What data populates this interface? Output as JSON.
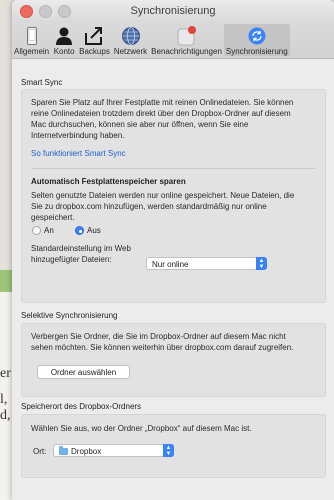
{
  "window": {
    "title": "Synchronisierung"
  },
  "toolbar": [
    {
      "label": "Allgemein",
      "icon": "phone-icon"
    },
    {
      "label": "Konto",
      "icon": "person-icon"
    },
    {
      "label": "Backups",
      "icon": "backup-icon"
    },
    {
      "label": "Netzwerk",
      "icon": "globe-icon"
    },
    {
      "label": "Benachrichtigungen",
      "icon": "notification-icon"
    },
    {
      "label": "Synchronisierung",
      "icon": "sync-icon",
      "active": true
    }
  ],
  "smart_sync": {
    "heading": "Smart Sync",
    "description": [
      "Sparen Sie Platz auf Ihrer Festplatte mit reinen Onlinedateien. Sie können",
      "reine Onlinedateien trotzdem direkt über den Dropbox-Ordner auf diesem",
      "Mac durchsuchen, können sie aber nur öffnen, wenn Sie eine",
      "Internetverbindung haben."
    ],
    "link": "So funktioniert Smart Sync",
    "auto_title": "Automatisch Festplattenspeicher sparen",
    "auto_text": [
      "Selten genutzte Dateien werden nur online gespeichert. Neue Dateien, die",
      "Sie zu dropbox.com hinzufügen, werden standardmäßig nur online",
      "gespeichert."
    ],
    "radio_on": "An",
    "radio_off": "Aus",
    "selected": "Aus",
    "default_label": [
      "Standardeinstellung im Web",
      "hinzugefügter Dateien:"
    ],
    "default_value": "Nur online"
  },
  "selective_sync": {
    "heading": "Selektive Synchronisierung",
    "text": [
      "Verbergen Sie Ordner, die Sie im Dropbox-Ordner auf diesem Mac nicht",
      "sehen möchten. Sie können weiterhin über dropbox.com darauf zugreifen."
    ],
    "button": "Ordner auswählen"
  },
  "location": {
    "heading": "Speicherort des Dropbox-Ordners",
    "text": "Wählen Sie aus, wo der Ordner „Dropbox“ auf diesem Mac ist.",
    "label": "Ort:",
    "value": "Dropbox"
  },
  "background_doc": [
    "er",
    "l,",
    "d,"
  ],
  "colors": {
    "accent": "#3a82f7",
    "link": "#1f5fd1"
  }
}
